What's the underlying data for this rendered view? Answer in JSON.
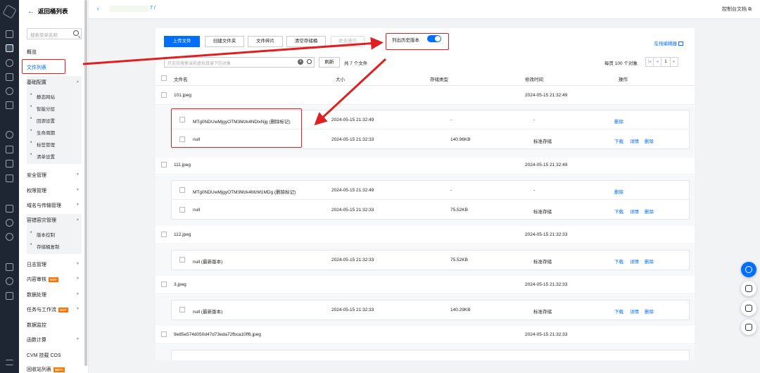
{
  "rail": {
    "icons": [
      "logo-icon",
      "dashboard-icon",
      "storage-icon",
      "link-icon",
      "calendar-icon",
      "chart-icon",
      "table-icon",
      "globe-icon",
      "flow-icon",
      "doc-icon",
      "db-icon",
      "cube-icon",
      "search-icon",
      "clock-icon",
      "list-icon",
      "shield-icon",
      "settings-icon",
      "menu-icon"
    ]
  },
  "sidebar": {
    "back_label": "返回桶列表",
    "search_placeholder": "搜索菜单名称",
    "overview": "概览",
    "file_list": "文件列表",
    "basic_config": "基础配置",
    "basic_sub": [
      "静态网站",
      "智能分层",
      "回源设置",
      "生命周期",
      "标签管理",
      "清单设置"
    ],
    "security": "安全管理",
    "permission": "权限管理",
    "domain": "域名与传输管理",
    "disaster": "容错容灾管理",
    "disaster_sub": [
      "版本控制",
      "存储桶复制"
    ],
    "log": "日志管理",
    "content_review": "内容审核",
    "data_process": "数据处理",
    "tasks": "任务与工作流",
    "data_monitor": "数据监控",
    "functions": "函数计算",
    "cvm": "CVM 挂载 COS",
    "recycle": "回收站列表",
    "hot_badge": "HOT",
    "beta_badge": "BETA"
  },
  "topbar": {
    "crumb": "7  /",
    "docs": "控制台文档 ⧉"
  },
  "toolbar": {
    "upload": "上传文件",
    "create_folder": "创建文件夹",
    "fragments": "文件碎片",
    "clear_bucket": "清空存储桶",
    "more": "更多操作",
    "history_toggle_label": "列出历史版本",
    "online_editor": "在线编辑器"
  },
  "search": {
    "placeholder": "只支持搜索当前虚拟目录下的对象",
    "refresh": "刷新",
    "total": "共 7 个文件"
  },
  "pagination": {
    "per_page": "每页 100 个对象",
    "page": "1"
  },
  "table": {
    "headers": {
      "name": "文件名",
      "size": "大小",
      "storage": "存储类型",
      "modified": "修改时间",
      "ops": "操作"
    },
    "groups": [
      {
        "name": "101.jpeg",
        "modified": "2024-05-15 21:32:49",
        "versions": [
          {
            "name": "MTg0NDUwMjgyOTM3Mzk4NDlxNjg (删除标记)",
            "date": "2024-05-15 21:32:49",
            "size": "-",
            "storage": "-",
            "ops": [
              "删除"
            ]
          },
          {
            "name": "null",
            "date": "2024-05-15 21:32:33",
            "size": "140.96KB",
            "storage": "标准存储",
            "ops": [
              "下载",
              "详情",
              "删除"
            ]
          }
        ]
      },
      {
        "name": "111.jpeg",
        "modified": "2024-05-15 21:32:49",
        "versions": [
          {
            "name": "MTg0NDUwMjgyOTM3Mzk4MzM1MDg (删除标记)",
            "date": "2024-05-15 21:32:49",
            "size": "-",
            "storage": "-",
            "ops": [
              "删除"
            ]
          },
          {
            "name": "null",
            "date": "2024-05-15 21:32:33",
            "size": "75.52KB",
            "storage": "标准存储",
            "ops": [
              "下载",
              "详情",
              "删除"
            ]
          }
        ]
      },
      {
        "name": "112.jpeg",
        "modified": "2024-05-15 21:32:33",
        "versions": [
          {
            "name": "null (最新版本)",
            "date": "2024-05-15 21:32:33",
            "size": "75.52KB",
            "storage": "标准存储",
            "ops": [
              "下载",
              "详情",
              "删除"
            ]
          }
        ]
      },
      {
        "name": "3.jpeg",
        "modified": "2024-05-15 21:32:33",
        "versions": [
          {
            "name": "null (最新版本)",
            "date": "2024-05-15 21:32:33",
            "size": "140.29KB",
            "storage": "标准存储",
            "ops": [
              "下载",
              "详情",
              "删除"
            ]
          }
        ]
      },
      {
        "name": "9e85e574d050d47d73eda72fbca10ff6.jpeg",
        "modified": "2024-05-15 21:32:33",
        "versions": []
      }
    ]
  },
  "annotation_color": "#e02020",
  "accent_color": "#006eff"
}
